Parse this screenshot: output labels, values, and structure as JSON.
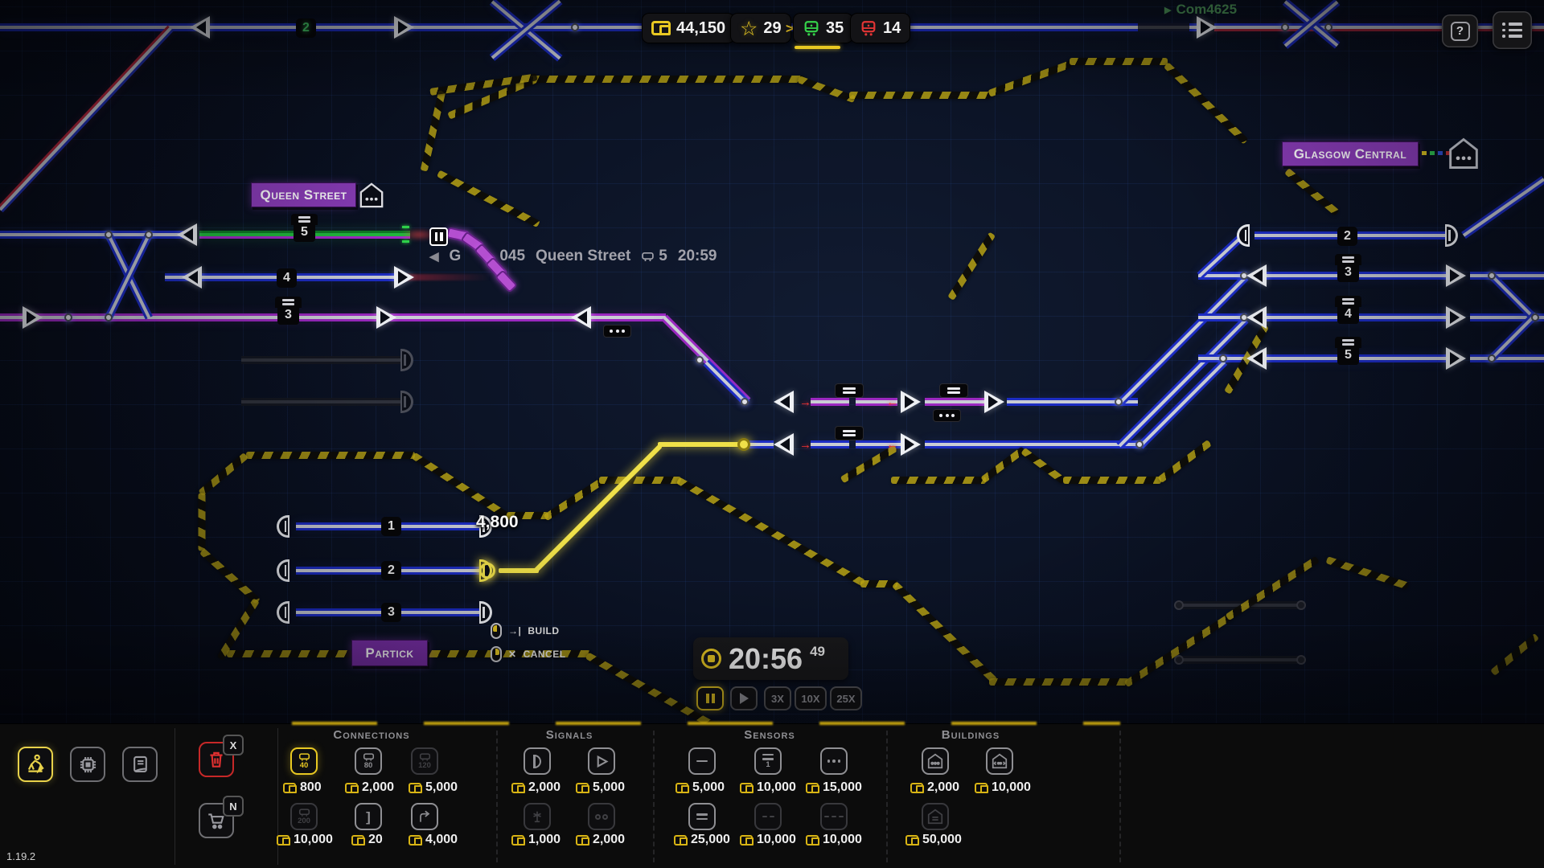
{
  "topbar": {
    "money": "44,150",
    "stars": "29",
    "trains_green": "35",
    "trains_red": "14",
    "chevron": ">",
    "com_label": "Com4625",
    "help_label": "?"
  },
  "map": {
    "labels": {
      "queen_street": "Queen Street",
      "glasgow_central": "Glasgow Central",
      "partick": "Partick"
    },
    "track2_label": "2",
    "left_platforms": {
      "p5": "5",
      "p4": "4",
      "p3": "3"
    },
    "right_platforms": {
      "p2": "2",
      "p3": "3",
      "p4": "4",
      "p5": "5"
    },
    "partick_platforms": {
      "p1": "1",
      "p2": "2",
      "p3": "3"
    },
    "build_cost": "4,800",
    "train_info": {
      "arrow": "◀",
      "id_prefix": "G",
      "id_num": "045",
      "station": "Queen Street",
      "platform": "5",
      "time": "20:59"
    },
    "hints": {
      "build_glyph": "→|",
      "build": "BUILD",
      "cancel_glyph": "✕",
      "cancel": "CANCEL"
    }
  },
  "clock": {
    "time": "20:56",
    "seconds": "49",
    "speed_3x": "3X",
    "speed_10x": "10X",
    "speed_25x": "25X"
  },
  "toolbar": {
    "version": "1.19.2",
    "hotkey_delete": "X",
    "hotkey_shop": "N",
    "connections": {
      "title": "Connections",
      "speed_40": "40",
      "speed_80": "80",
      "speed_120": "120",
      "speed_200": "200",
      "bumper_glyph": "]",
      "cost_40": "800",
      "cost_80": "2,000",
      "cost_120": "5,000",
      "cost_200": "10,000",
      "cost_bumper": "20",
      "cost_switch": "4,000"
    },
    "signals": {
      "title": "Signals",
      "cost_signal": "2,000",
      "cost_auto": "5,000",
      "cost_gate": "1,000",
      "cost_chain": "2,000"
    },
    "sensors": {
      "title": "Sensors",
      "sensor_one": "1",
      "cost_1": "5,000",
      "cost_2": "10,000",
      "cost_3": "15,000",
      "cost_4": "25,000",
      "cost_5": "10,000",
      "cost_6": "10,000"
    },
    "buildings": {
      "title": "Buildings",
      "cost_station": "2,000",
      "cost_station2": "10,000",
      "cost_depot": "50,000"
    }
  }
}
